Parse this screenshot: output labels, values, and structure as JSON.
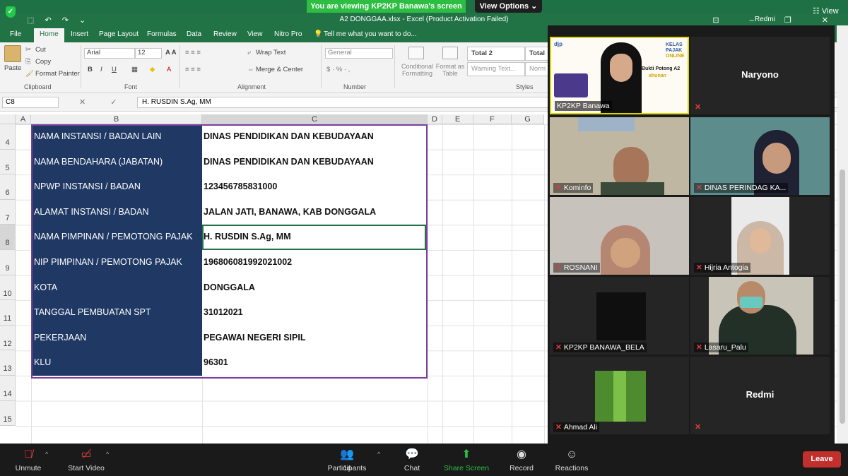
{
  "zoom": {
    "banner": "You are viewing KP2KP Banawa's screen",
    "view_options": "View Options ⌄",
    "view_label": "☷ View",
    "toolbar": {
      "unmute": "Unmute",
      "start_video": "Start Video",
      "participants": "Participants",
      "participants_count": "14",
      "chat": "Chat",
      "share_screen": "Share Screen",
      "record": "Record",
      "reactions": "Reactions",
      "leave": "Leave"
    },
    "tiles": [
      {
        "name": "KP2KP Banawa"
      },
      {
        "name": "Naryono"
      },
      {
        "name": "Kominfo"
      },
      {
        "name": "DINAS PERINDAG KA..."
      },
      {
        "name": "ROSNANI"
      },
      {
        "name": "Hijria Antogia"
      },
      {
        "name": "KP2KP BANAWA_BELA"
      },
      {
        "name": "Lasaru_Palu"
      },
      {
        "name": "Ahmad Ali"
      },
      {
        "name": "Redmi"
      }
    ],
    "slide": {
      "brand": "djp",
      "kelas": "KELAS",
      "pajak": "PAJAK",
      "online": "ONLINE",
      "text1": "Bukti Potong A2",
      "text2": "ahunan"
    }
  },
  "excel": {
    "title": "A2 DONGGAA.xlsx - Excel (Product Activation Failed)",
    "redmi": "Redmi",
    "tabs": [
      "File",
      "Home",
      "Insert",
      "Page Layout",
      "Formulas",
      "Data",
      "Review",
      "View",
      "Nitro Pro"
    ],
    "tell_me": "Tell me what you want to do...",
    "clipboard": {
      "paste": "Paste",
      "cut": "Cut",
      "copy": "Copy",
      "format_painter": "Format Painter",
      "label": "Clipboard"
    },
    "font": {
      "name": "Arial",
      "size": "12",
      "label": "Font"
    },
    "alignment": {
      "wrap": "Wrap Text",
      "merge": "Merge & Center",
      "label": "Alignment"
    },
    "number": {
      "format": "General",
      "label": "Number"
    },
    "styles": {
      "conditional": "Conditional Formatting",
      "format_as": "Format as Table",
      "total2": "Total 2",
      "total": "Total",
      "warning": "Warning Text...",
      "normal": "Norm",
      "label": "Styles"
    },
    "name_box": "C8",
    "formula": "H. RUSDIN S.Ag, MM",
    "columns": [
      "A",
      "B",
      "C",
      "D",
      "E",
      "F",
      "G"
    ],
    "rows": [
      {
        "num": "4",
        "label": "NAMA INSTANSI / BADAN LAIN",
        "value": "DINAS PENDIDIKAN DAN KEBUDAYAAN"
      },
      {
        "num": "5",
        "label": "NAMA BENDAHARA (JABATAN)",
        "value": "DINAS PENDIDIKAN DAN KEBUDAYAAN"
      },
      {
        "num": "6",
        "label": "NPWP INSTANSI / BADAN",
        "value": "123456785831000"
      },
      {
        "num": "7",
        "label": "ALAMAT INSTANSI / BADAN",
        "value": "JALAN JATI, BANAWA, KAB DONGGALA"
      },
      {
        "num": "8",
        "label": "NAMA PIMPINAN / PEMOTONG PAJAK",
        "value": "H. RUSDIN S.Ag, MM"
      },
      {
        "num": "9",
        "label": "NIP PIMPINAN / PEMOTONG PAJAK",
        "value": "196806081992021002"
      },
      {
        "num": "10",
        "label": "KOTA",
        "value": "DONGGALA"
      },
      {
        "num": "11",
        "label": "TANGGAL PEMBUATAN SPT",
        "value": "31012021"
      },
      {
        "num": "12",
        "label": "PEKERJAAN",
        "value": "PEGAWAI NEGERI SIPIL"
      },
      {
        "num": "13",
        "label": "KLU",
        "value": "96301"
      },
      {
        "num": "14",
        "label": "",
        "value": ""
      },
      {
        "num": "15",
        "label": "",
        "value": ""
      }
    ]
  }
}
